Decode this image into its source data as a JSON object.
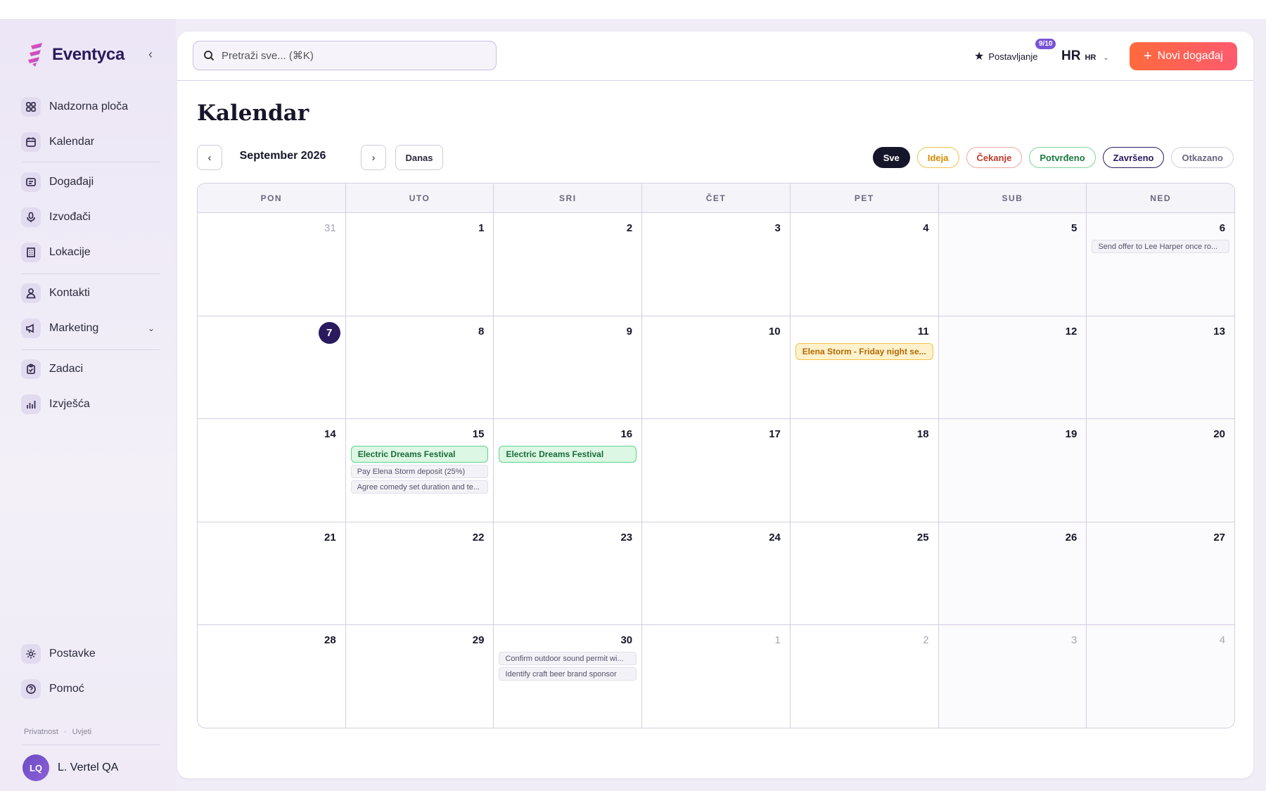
{
  "app": {
    "name": "Eventyca"
  },
  "sidebar": {
    "items": [
      {
        "label": "Nadzorna ploča",
        "icon": "grid-icon"
      },
      {
        "label": "Kalendar",
        "icon": "calendar-icon"
      },
      {
        "label": "Događaji",
        "icon": "ticket-icon"
      },
      {
        "label": "Izvođači",
        "icon": "microphone-icon"
      },
      {
        "label": "Lokacije",
        "icon": "building-icon"
      },
      {
        "label": "Kontakti",
        "icon": "user-icon"
      },
      {
        "label": "Marketing",
        "icon": "megaphone-icon"
      },
      {
        "label": "Zadaci",
        "icon": "clipboard-icon"
      },
      {
        "label": "Izvješća",
        "icon": "bar-chart-icon"
      }
    ],
    "bottom": [
      {
        "label": "Postavke",
        "icon": "gear-icon"
      },
      {
        "label": "Pomoć",
        "icon": "help-icon"
      }
    ],
    "legal": {
      "privacy": "Privatnost",
      "sep": "·",
      "terms": "Uvjeti"
    },
    "user": {
      "initials": "LQ",
      "name": "L. Vertel QA"
    }
  },
  "header": {
    "search_placeholder": "Pretraži sve... (⌘K)",
    "setup_label": "Postavljanje",
    "setup_badge": "9/10",
    "lang_big": "HR",
    "lang_small": "HR",
    "new_event_label": "Novi događaj"
  },
  "calendar": {
    "title": "Kalendar",
    "month_label": "September 2026",
    "today_label": "Danas",
    "filters": [
      {
        "label": "Sve",
        "bg": "#16162a",
        "fg": "#ffffff",
        "border": "#16162a"
      },
      {
        "label": "Ideja",
        "bg": "#ffffff",
        "fg": "#d68a00",
        "border": "#f1c24a"
      },
      {
        "label": "Čekanje",
        "bg": "#ffffff",
        "fg": "#c0392b",
        "border": "#f0a8a0"
      },
      {
        "label": "Potvrđeno",
        "bg": "#ffffff",
        "fg": "#1a7a3e",
        "border": "#7fd49c"
      },
      {
        "label": "Završeno",
        "bg": "#ffffff",
        "fg": "#2a1a5e",
        "border": "#2a1a5e"
      },
      {
        "label": "Otkazano",
        "bg": "#ffffff",
        "fg": "#6a6680",
        "border": "#d4cee2"
      }
    ],
    "weekdays": [
      "PON",
      "UTO",
      "SRI",
      "ČET",
      "PET",
      "SUB",
      "NED"
    ],
    "weeks": [
      [
        {
          "day": "31",
          "muted": true
        },
        {
          "day": "1"
        },
        {
          "day": "2"
        },
        {
          "day": "3"
        },
        {
          "day": "4"
        },
        {
          "day": "5"
        },
        {
          "day": "6",
          "tasks": [
            "Send offer to Lee Harper once ro..."
          ]
        }
      ],
      [
        {
          "day": "7",
          "today": true
        },
        {
          "day": "8"
        },
        {
          "day": "9"
        },
        {
          "day": "10"
        },
        {
          "day": "11",
          "events": [
            {
              "label": "Elena Storm - Friday night se...",
              "color": "yellow"
            }
          ]
        },
        {
          "day": "12"
        },
        {
          "day": "13"
        }
      ],
      [
        {
          "day": "14"
        },
        {
          "day": "15",
          "events": [
            {
              "label": "Electric Dreams Festival",
              "color": "green"
            }
          ],
          "tasks": [
            "Pay Elena Storm deposit (25%)",
            "Agree comedy set duration and te..."
          ]
        },
        {
          "day": "16",
          "events": [
            {
              "label": "Electric Dreams Festival",
              "color": "green"
            }
          ]
        },
        {
          "day": "17"
        },
        {
          "day": "18"
        },
        {
          "day": "19"
        },
        {
          "day": "20"
        }
      ],
      [
        {
          "day": "21"
        },
        {
          "day": "22"
        },
        {
          "day": "23"
        },
        {
          "day": "24"
        },
        {
          "day": "25"
        },
        {
          "day": "26"
        },
        {
          "day": "27"
        }
      ],
      [
        {
          "day": "28"
        },
        {
          "day": "29"
        },
        {
          "day": "30",
          "tasks": [
            "Confirm outdoor sound permit wi...",
            "Identify craft beer brand sponsor"
          ]
        },
        {
          "day": "1",
          "muted": true
        },
        {
          "day": "2",
          "muted": true
        },
        {
          "day": "3",
          "muted": true
        },
        {
          "day": "4",
          "muted": true
        }
      ]
    ]
  }
}
